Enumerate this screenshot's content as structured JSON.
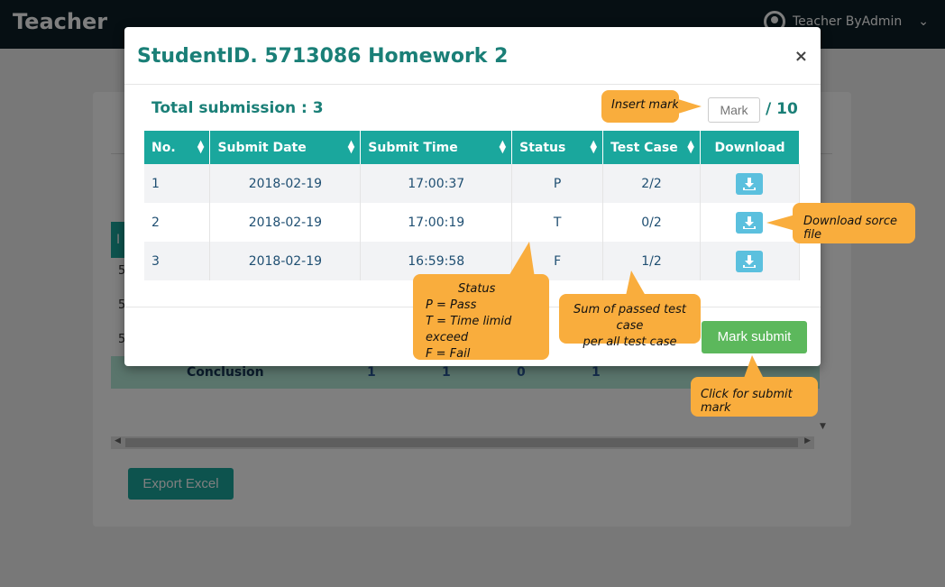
{
  "app": {
    "brand": "Teacher",
    "user_name": "Teacher ByAdmin",
    "user_icon": "user-circle-icon",
    "menu_icon": "chevron-down-icon"
  },
  "background": {
    "row_prefix": [
      "5",
      "5",
      "5"
    ],
    "conclusion_label": "Conclusion",
    "conclusion_values": [
      "1",
      "1",
      "0",
      "1"
    ],
    "export_label": "Export Excel"
  },
  "modal": {
    "title": "StudentID. 5713086 Homework 2",
    "close_label": "×",
    "total_label": "Total submission : 3",
    "mark_placeholder": "Mark",
    "mark_max": "/ 10",
    "submit_label": "Mark submit",
    "columns": [
      "No.",
      "Submit Date",
      "Submit Time",
      "Status",
      "Test Case",
      "Download"
    ],
    "rows": [
      {
        "no": "1",
        "date": "2018-02-19",
        "time": "17:00:37",
        "status": "P",
        "test_case": "2/2"
      },
      {
        "no": "2",
        "date": "2018-02-19",
        "time": "17:00:19",
        "status": "T",
        "test_case": "0/2"
      },
      {
        "no": "3",
        "date": "2018-02-19",
        "time": "16:59:58",
        "status": "F",
        "test_case": "1/2"
      }
    ]
  },
  "callouts": {
    "insert_mark": "Insert mark",
    "download": "Download sorce file",
    "status_title": "Status",
    "status_p": "P = Pass",
    "status_t": "T = Time limid exceed",
    "status_f": "F = Fail",
    "testcase_line1": "Sum of passed test case",
    "testcase_line2": "per all test case",
    "submit": "Click for submit mark"
  },
  "colors": {
    "accent": "#1aa79d",
    "title_text": "#1a7f77",
    "download_button": "#5bc0de",
    "submit_button": "#5cb85c",
    "callout": "#f9ad3d"
  }
}
